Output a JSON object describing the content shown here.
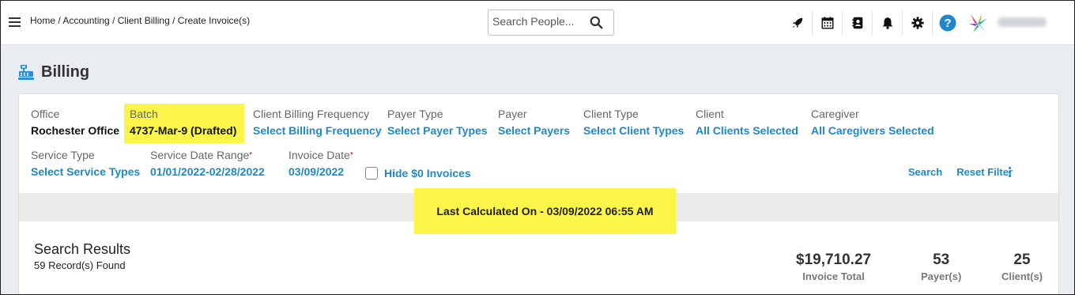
{
  "breadcrumb": [
    "Home",
    "Accounting",
    "Client Billing",
    "Create Invoice(s)"
  ],
  "search": {
    "placeholder": "Search People..."
  },
  "topicons": [
    "rocket-icon",
    "calendar-icon",
    "contacts-icon",
    "bell-icon",
    "gear-icon",
    "help-icon"
  ],
  "page": {
    "title": "Billing"
  },
  "filters": {
    "office": {
      "label": "Office",
      "value": "Rochester Office"
    },
    "batch": {
      "label": "Batch",
      "value": "4737-Mar-9 (Drafted)"
    },
    "billing_frequency": {
      "label": "Client Billing Frequency",
      "value": "Select Billing Frequency"
    },
    "payer_type": {
      "label": "Payer Type",
      "value": "Select Payer Types"
    },
    "payer": {
      "label": "Payer",
      "value": "Select Payers"
    },
    "client_type": {
      "label": "Client Type",
      "value": "Select Client Types"
    },
    "client": {
      "label": "Client",
      "value": "All Clients Selected"
    },
    "caregiver": {
      "label": "Caregiver",
      "value": "All Caregivers Selected"
    },
    "service_type": {
      "label": "Service Type",
      "value": "Select Service Types"
    },
    "service_date_range": {
      "label": "Service Date Range",
      "value": "01/01/2022-02/28/2022",
      "required": "*"
    },
    "invoice_date": {
      "label": "Invoice Date",
      "value": "03/09/2022",
      "required": "*"
    },
    "hide_zero": {
      "label": "Hide $0 Invoices",
      "checked": false
    }
  },
  "actions": {
    "search": "Search",
    "reset": "Reset Filter"
  },
  "last_calculated": "Last Calculated On - 03/09/2022 06:55 AM",
  "results": {
    "title": "Search Results",
    "count": "59 Record(s) Found",
    "invoice_total": {
      "value": "$19,710.27",
      "label": "Invoice Total"
    },
    "payers": {
      "value": "53",
      "label": "Payer(s)"
    },
    "clients": {
      "value": "25",
      "label": "Client(s)"
    }
  },
  "colors": {
    "link": "#1e88c9",
    "highlight": "#fbf54a",
    "help": "#1e88c9"
  }
}
